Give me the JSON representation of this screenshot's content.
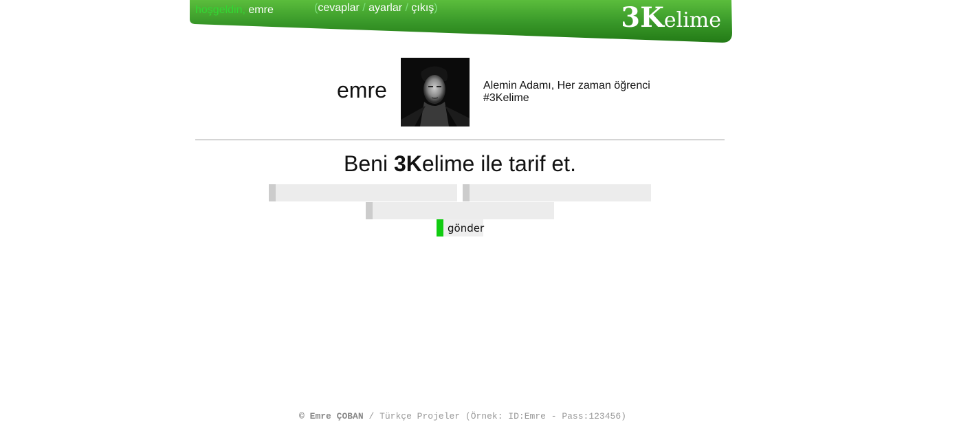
{
  "header": {
    "greeting": "hoşgeldin,",
    "username": "emre",
    "nav_open": "(",
    "nav_close": ")",
    "nav_separator": " / ",
    "nav_items": [
      {
        "label": "cevaplar"
      },
      {
        "label": "ayarlar"
      },
      {
        "label": "çıkış"
      }
    ],
    "logo_big": "3K",
    "logo_rest": "elime"
  },
  "profile": {
    "name": "emre",
    "bio_line1": "Alemin Adamı, Her zaman öğrenci",
    "bio_line2": "#3Kelime"
  },
  "form": {
    "prompt_before": "Beni ",
    "prompt_bold": "3K",
    "prompt_after": "elime ile tarif et.",
    "word1_value": "",
    "word2_value": "",
    "word3_value": "",
    "submit_label": "gönder"
  },
  "footer": {
    "author": "© Emre ÇOBAN",
    "rest": " / Türkçe Projeler (Örnek: ID:Emre - Pass:123456)"
  },
  "colors": {
    "banner_green": "#2e8b1f",
    "banner_green_light": "#5bbd3c",
    "greeting_green": "#33d633",
    "submit_accent": "#11cc11",
    "input_bg": "#ececec",
    "input_accent": "#cccccc"
  }
}
